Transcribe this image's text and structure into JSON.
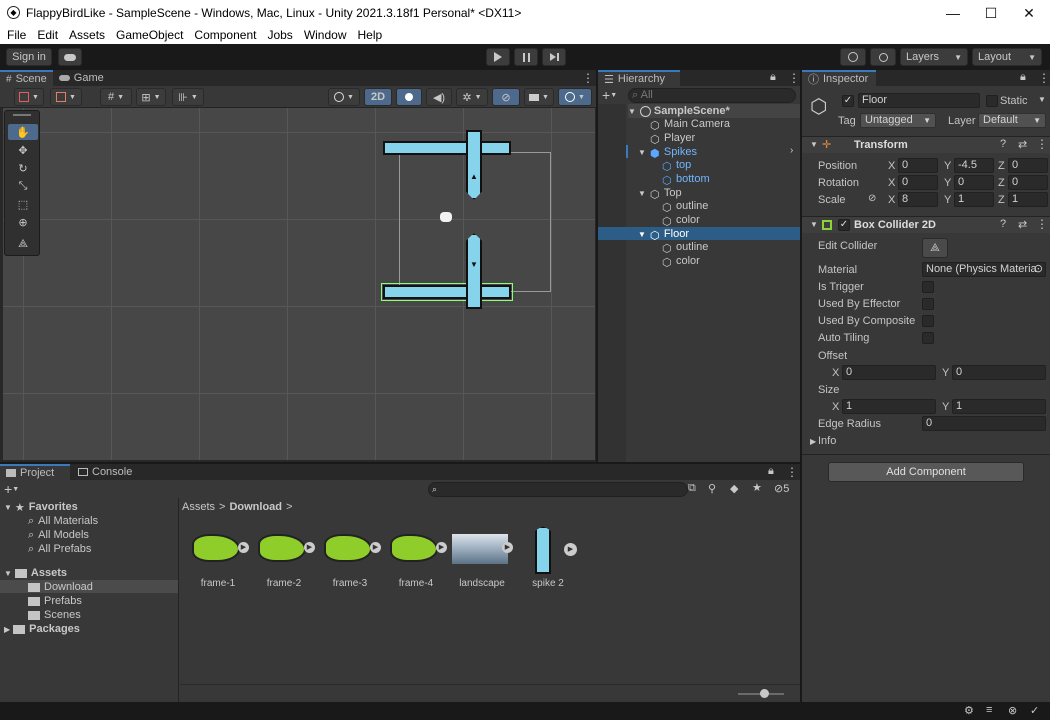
{
  "window": {
    "title": "FlappyBirdLike - SampleScene - Windows, Mac, Linux - Unity 2021.3.18f1 Personal* <DX11>",
    "minimize": "—",
    "maximize": "☐",
    "close": "✕"
  },
  "menu": [
    "File",
    "Edit",
    "Assets",
    "GameObject",
    "Component",
    "Jobs",
    "Window",
    "Help"
  ],
  "toolbar": {
    "sign_in": "Sign in",
    "layers": "Layers",
    "layout": "Layout"
  },
  "scene_tabs": {
    "scene": "Scene",
    "game": "Game"
  },
  "scene_toolbar": {
    "mode_2d": "2D"
  },
  "hierarchy": {
    "title": "Hierarchy",
    "search_placeholder": "All",
    "items": [
      {
        "label": "SampleScene*"
      },
      {
        "label": "Main Camera"
      },
      {
        "label": "Player"
      },
      {
        "label": "Spikes"
      },
      {
        "label": "top"
      },
      {
        "label": "bottom"
      },
      {
        "label": "Top"
      },
      {
        "label": "outline"
      },
      {
        "label": "color"
      },
      {
        "label": "Floor"
      },
      {
        "label": "outline"
      },
      {
        "label": "color"
      }
    ]
  },
  "inspector": {
    "title": "Inspector",
    "object_name": "Floor",
    "static_label": "Static",
    "tag_label": "Tag",
    "tag_value": "Untagged",
    "layer_label": "Layer",
    "layer_value": "Default",
    "transform": {
      "title": "Transform",
      "position": {
        "label": "Position",
        "x": "0",
        "y": "-4.5",
        "z": "0"
      },
      "rotation": {
        "label": "Rotation",
        "x": "0",
        "y": "0",
        "z": "0"
      },
      "scale": {
        "label": "Scale",
        "x": "8",
        "y": "1",
        "z": "1"
      }
    },
    "box_collider": {
      "title": "Box Collider 2D",
      "edit_collider": "Edit Collider",
      "material_label": "Material",
      "material_value": "None (Physics Materia",
      "is_trigger": "Is Trigger",
      "used_by_effector": "Used By Effector",
      "used_by_composite": "Used By Composite",
      "auto_tiling": "Auto Tiling",
      "offset_label": "Offset",
      "offset": {
        "x": "0",
        "y": "0"
      },
      "size_label": "Size",
      "size": {
        "x": "1",
        "y": "1"
      },
      "edge_radius_label": "Edge Radius",
      "edge_radius_value": "0",
      "info_label": "Info"
    },
    "add_component": "Add Component",
    "axis": {
      "x": "X",
      "y": "Y",
      "z": "Z"
    }
  },
  "project": {
    "tabs": {
      "project": "Project",
      "console": "Console"
    },
    "hidden_count": "5",
    "favorites": {
      "label": "Favorites",
      "items": [
        "All Materials",
        "All Models",
        "All Prefabs"
      ]
    },
    "assets_root": "Assets",
    "folders": [
      "Download",
      "Prefabs",
      "Scenes"
    ],
    "packages": "Packages",
    "breadcrumb": [
      "Assets",
      "Download"
    ],
    "breadcrumb_sep": ">",
    "assets": [
      {
        "name": "frame-1"
      },
      {
        "name": "frame-2"
      },
      {
        "name": "frame-3"
      },
      {
        "name": "frame-4"
      },
      {
        "name": "landscape"
      },
      {
        "name": "spike 2"
      }
    ]
  },
  "colors": {
    "accent_blue": "#3a79bb",
    "selection": "#2c5d87",
    "spike": "#86d3ec",
    "collider_green": "#8bff7a",
    "bird_green": "#8fce2a"
  }
}
